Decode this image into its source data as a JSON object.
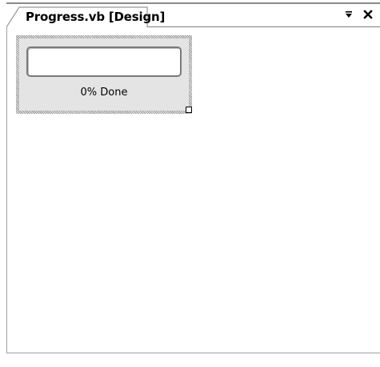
{
  "tab": {
    "title": "Progress.vb [Design]"
  },
  "window_controls": {
    "dropdown_icon": "dropdown-arrow-icon",
    "close_icon": "close-icon"
  },
  "designer": {
    "progress_value_fraction": 0,
    "status_text": "0% Done"
  },
  "colors": {
    "background": "#ffffff",
    "control_face": "#e4e4e4",
    "progress_fill": "#3a6fd0"
  }
}
